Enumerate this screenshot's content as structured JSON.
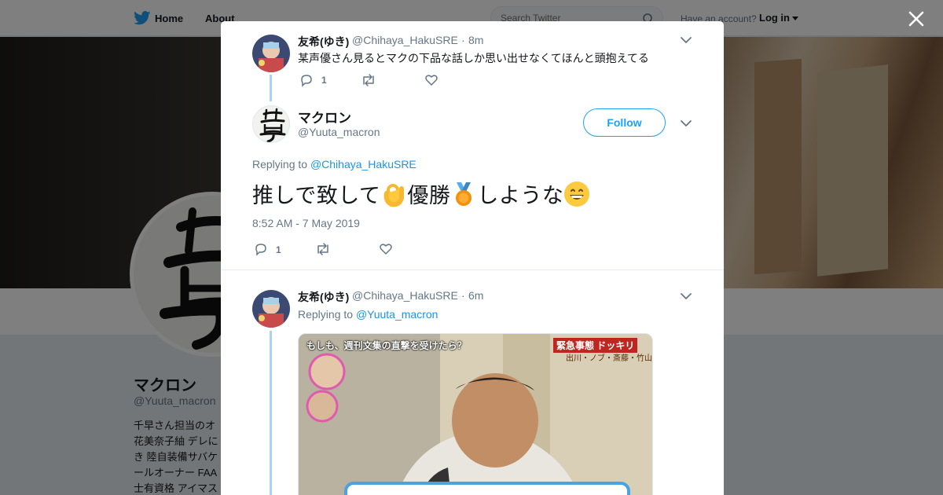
{
  "nav": {
    "home_label": "Home",
    "about_label": "About",
    "search_placeholder": "Search Twitter",
    "account_prompt": "Have an account?",
    "login_label": "Log in"
  },
  "profile": {
    "name": "マクロン",
    "handle": "@Yuuta_macron",
    "bio_lines": [
      "千早さん担当のオ",
      "花美奈子紬 デレに",
      "き 陸自装備サバケ",
      "ールオーナー FAA",
      "士有資格 アイマス"
    ]
  },
  "modal": {
    "parent_tweet": {
      "name": "友希(ゆき)",
      "handle": "@Chihaya_HakuSRE",
      "separator": "·",
      "time": "8m",
      "text": "某声優さん見るとマクの下品な話しか思い出せなくてほんと頭抱えてる",
      "reply_count": "1"
    },
    "main_tweet": {
      "name": "マクロン",
      "handle": "@Yuuta_macron",
      "follow_label": "Follow",
      "replying_prefix": "Replying to",
      "replying_to": "@Chihaya_HakuSRE",
      "text_part1": "推しで致して",
      "text_part2": "優勝",
      "text_part3": "しような",
      "timestamp": "8:52 AM - 7 May 2019",
      "reply_count": "1"
    },
    "reply_tweet": {
      "name": "友希(ゆき)",
      "handle": "@Chihaya_HakuSRE",
      "separator": "·",
      "time": "6m",
      "replying_prefix": "Replying to",
      "replying_to": "@Yuuta_macron",
      "media_caption_left": "もしも、週刊文集の直撃を受けたら？",
      "media_badge": "緊急事態 ドッキリ",
      "media_names": "出川・ノブ・斎藤・竹山"
    }
  },
  "colors": {
    "accent": "#1da1f2",
    "link": "#1b95e0",
    "thread_line": "#a4d3f5",
    "muted": "#657786"
  }
}
